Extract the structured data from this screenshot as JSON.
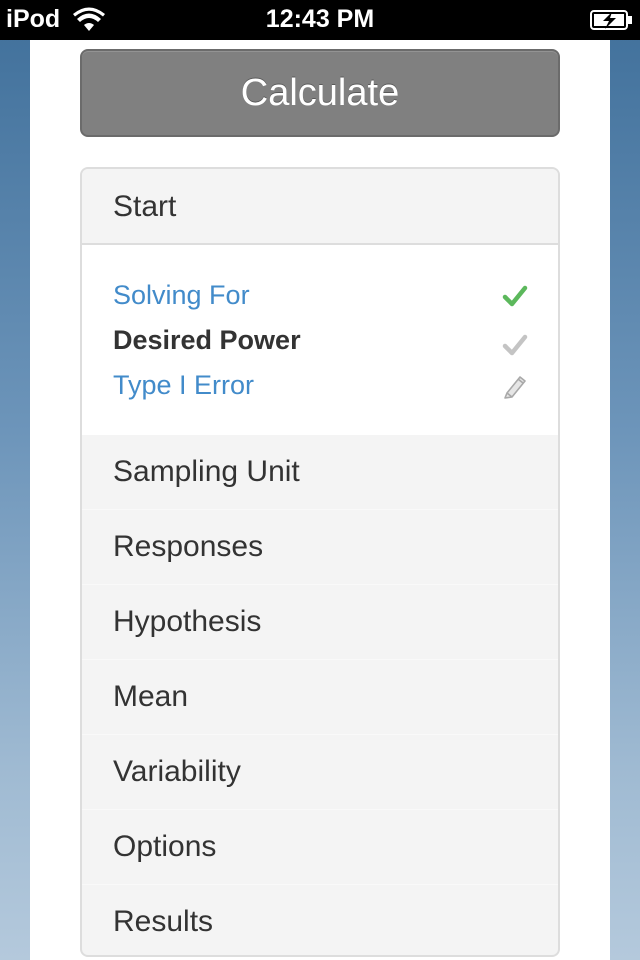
{
  "status_bar": {
    "carrier": "iPod",
    "time": "12:43 PM"
  },
  "toolbar": {
    "calculate_label": "Calculate"
  },
  "card": {
    "header": "Start",
    "fields": [
      {
        "label": "Solving For",
        "state": "completed",
        "icon": "checkmark-green-icon"
      },
      {
        "label": "Desired Power",
        "state": "current",
        "icon": "checkmark-gray-icon"
      },
      {
        "label": "Type I Error",
        "state": "editable",
        "icon": "pencil-icon"
      }
    ],
    "menu": [
      "Sampling Unit",
      "Responses",
      "Hypothesis",
      "Mean",
      "Variability",
      "Options",
      "Results"
    ]
  },
  "colors": {
    "link_blue": "#428bca",
    "check_green": "#5cb85c",
    "button_gray": "#808080"
  }
}
